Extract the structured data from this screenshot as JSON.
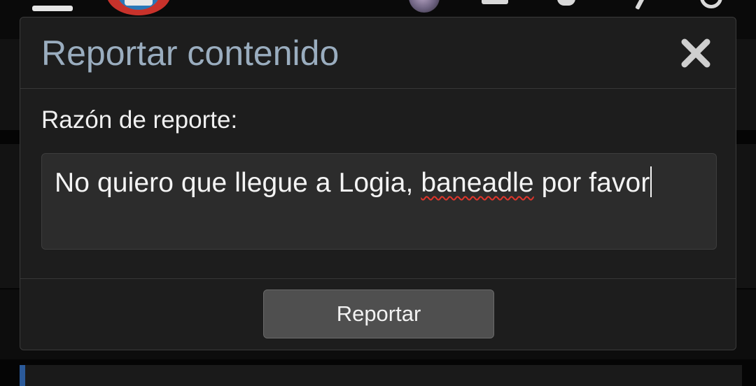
{
  "modal": {
    "title": "Reportar contenido",
    "close_icon": "close-icon",
    "field_label": "Razón de reporte:",
    "reason": {
      "before": "No quiero que llegue a Logia, ",
      "misspelled_word": "baneadle",
      "after": " por favor"
    },
    "submit_label": "Reportar"
  },
  "background_header": {
    "icons": [
      "menu-icon",
      "site-logo",
      "avatar",
      "inbox-icon",
      "bell-icon",
      "edit-icon",
      "search-icon"
    ]
  },
  "colors": {
    "title": "#9aadbf",
    "misspelling_underline": "#e0352b",
    "button_bg": "#4f4f4f"
  }
}
